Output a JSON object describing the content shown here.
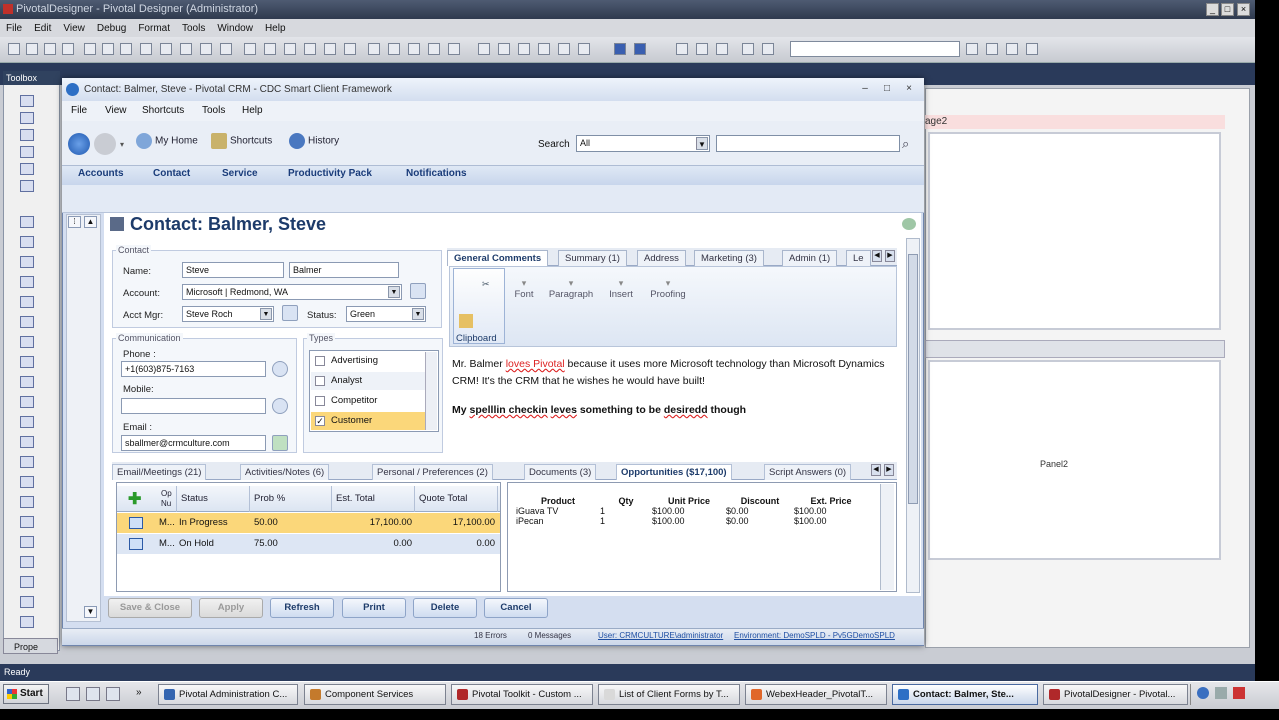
{
  "designer": {
    "title": "PivotalDesigner - Pivotal Designer (Administrator)",
    "menu": [
      "File",
      "Edit",
      "View",
      "Debug",
      "Format",
      "Tools",
      "Window",
      "Help"
    ],
    "toolbox_label": "Toolbox",
    "panel2_label": "Panel2",
    "page2_label": "age2",
    "status": "Ready",
    "props_tab": "Prope"
  },
  "window": {
    "title": "Contact: Balmer, Steve - Pivotal CRM - CDC Smart Client Framework",
    "menu": [
      "File",
      "View",
      "Shortcuts",
      "Tools",
      "Help"
    ],
    "nav_buttons": [
      "My Home",
      "Shortcuts",
      "History"
    ],
    "search_label": "Search",
    "search_scope": "All",
    "search_value": "",
    "nav_tabs": [
      "Accounts",
      "Contact",
      "Service",
      "Productivity Pack",
      "Notifications"
    ]
  },
  "form": {
    "heading": "Contact: Balmer, Steve",
    "contact_group": "Contact",
    "name_label": "Name:",
    "first_name": "Steve",
    "last_name": "Balmer",
    "account_label": "Account:",
    "account_value": "Microsoft | Redmond, WA",
    "acct_mgr_label": "Acct Mgr:",
    "acct_mgr_value": "Steve Roch",
    "status_label": "Status:",
    "status_value": "Green",
    "comm_group": "Communication",
    "phone_label": "Phone :",
    "phone_value": "+1(603)875-7163",
    "mobile_label": "Mobile:",
    "mobile_value": "",
    "email_label": "Email :",
    "email_value": "sballmer@crmculture.com",
    "types_group": "Types",
    "types": [
      {
        "label": "Advertising",
        "checked": false
      },
      {
        "label": "Analyst",
        "checked": false
      },
      {
        "label": "Competitor",
        "checked": false
      },
      {
        "label": "Customer",
        "checked": true
      }
    ]
  },
  "comments": {
    "tabs": [
      "General Comments",
      "Summary (1)",
      "Address",
      "Marketing (3)",
      "Admin (1)",
      "Le"
    ],
    "ribbon_groups": [
      "Font",
      "Paragraph",
      "Insert",
      "Proofing"
    ],
    "clipboard": "Clipboard",
    "p1_pre": "Mr. Balmer ",
    "p1_squiggle": "loves Pivotal",
    "p1_post": " because it uses more Microsoft technology than Microsoft Dynamics CRM! It's the CRM that he wishes he would have built!",
    "p2_a": "My ",
    "p2_b": "spelllin checkin",
    "p2_c": " ",
    "p2_d": "leves",
    "p2_e": " something to be ",
    "p2_f": "desiredd",
    "p2_g": " though"
  },
  "bottom": {
    "tabs": [
      "Email/Meetings (21)",
      "Activities/Notes (6)",
      "Personal / Preferences (2)",
      "Documents (3)",
      "Opportunities ($17,100)",
      "Script Answers (0)"
    ],
    "grid_headers": [
      "Op Nu",
      "Status",
      "Prob %",
      "Est. Total",
      "Quote Total"
    ],
    "grid_rows": [
      [
        "M...",
        "In Progress",
        "50.00",
        "17,100.00",
        "17,100.00"
      ],
      [
        "M...",
        "On Hold",
        "75.00",
        "0.00",
        "0.00"
      ]
    ],
    "prod_headers": [
      "Product",
      "Qty",
      "Unit Price",
      "Discount",
      "Ext. Price"
    ],
    "prod_rows": [
      [
        "iGuava TV",
        "1",
        "$100.00",
        "$0.00",
        "$100.00"
      ],
      [
        "iPecan",
        "1",
        "$100.00",
        "$0.00",
        "$100.00"
      ]
    ]
  },
  "actions": [
    "Save & Close",
    "Apply",
    "Refresh",
    "Print",
    "Delete",
    "Cancel"
  ],
  "win_status": [
    "18 Errors",
    "0 Messages",
    "User: CRMCULTURE\\administrator",
    "Environment: DemoSPLD - Pv5GDemoSPLD"
  ],
  "taskbar": {
    "start": "Start",
    "items": [
      "Pivotal Administration C...",
      "Component Services",
      "Pivotal Toolkit - Custom ...",
      "List of Client Forms by T...",
      "WebexHeader_PivotalT...",
      "Contact: Balmer, Ste...",
      "PivotalDesigner - Pivotal..."
    ]
  }
}
